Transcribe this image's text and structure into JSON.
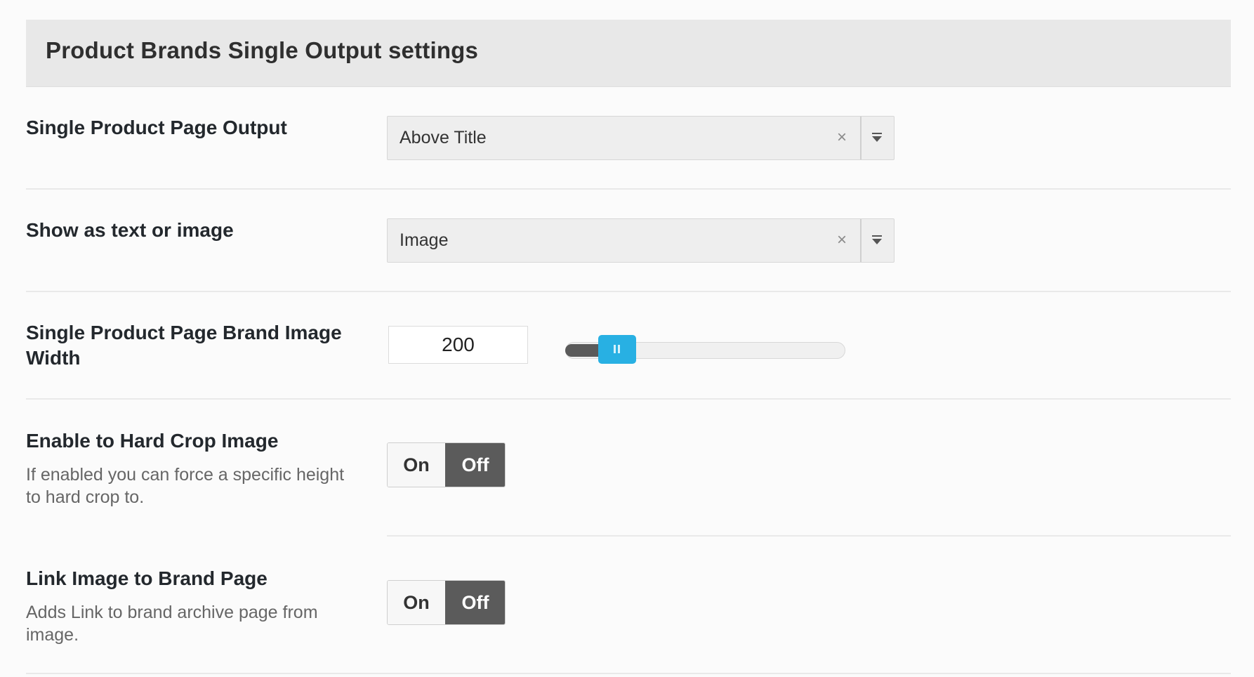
{
  "panel": {
    "title": "Product Brands Single Output settings"
  },
  "fields": {
    "single_output": {
      "label": "Single Product Page Output",
      "value": "Above Title",
      "clear_glyph": "×"
    },
    "show_as": {
      "label": "Show as text or image",
      "value": "Image",
      "clear_glyph": "×"
    },
    "image_width": {
      "label": "Single Product Page Brand Image Width",
      "value": "200",
      "slider_level": 0.12,
      "handle_color": "#28b0e3"
    },
    "hard_crop": {
      "label": "Enable to Hard Crop Image",
      "description": "If enabled you can force a specific height to hard crop to.",
      "on_label": "On",
      "off_label": "Off",
      "state": "Off"
    },
    "link_image": {
      "label": "Link Image to Brand Page",
      "description": "Adds Link to brand archive page from image.",
      "on_label": "On",
      "off_label": "Off",
      "state": "Off"
    }
  },
  "icons": {
    "clear": "close-icon",
    "dropdown": "chevron-down-icon",
    "grip": "grip-icon"
  }
}
